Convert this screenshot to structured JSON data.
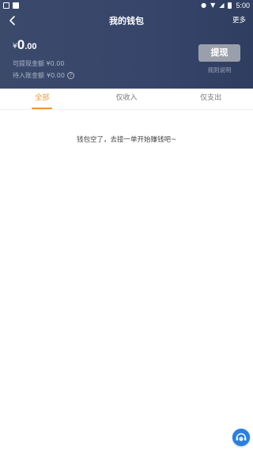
{
  "status_bar": {
    "time": "5:00"
  },
  "nav": {
    "title": "我的钱包",
    "more_label": "更多"
  },
  "balance": {
    "currency": "¥",
    "integer": "0",
    "decimal": ".00",
    "withdrawable_label": "可提现金额",
    "withdrawable_value": "¥0.00",
    "pending_label": "待入账金额",
    "pending_value": "¥0.00"
  },
  "actions": {
    "withdraw_label": "提现",
    "rules_label": "规则说明"
  },
  "tabs": [
    {
      "label": "全部",
      "active": true
    },
    {
      "label": "仅收入",
      "active": false
    },
    {
      "label": "仅支出",
      "active": false
    }
  ],
  "empty_message": "钱包空了，去接一单开始赚钱吧~",
  "colors": {
    "header": "#36456a",
    "accent": "#f0962a",
    "withdraw_button": "#9aa0ab",
    "service_button": "#2b7fe0"
  },
  "icons": [
    "back-arrow-icon",
    "help-icon",
    "customer-service-icon",
    "wifi-icon",
    "signal-icon",
    "location-icon",
    "battery-icon"
  ]
}
